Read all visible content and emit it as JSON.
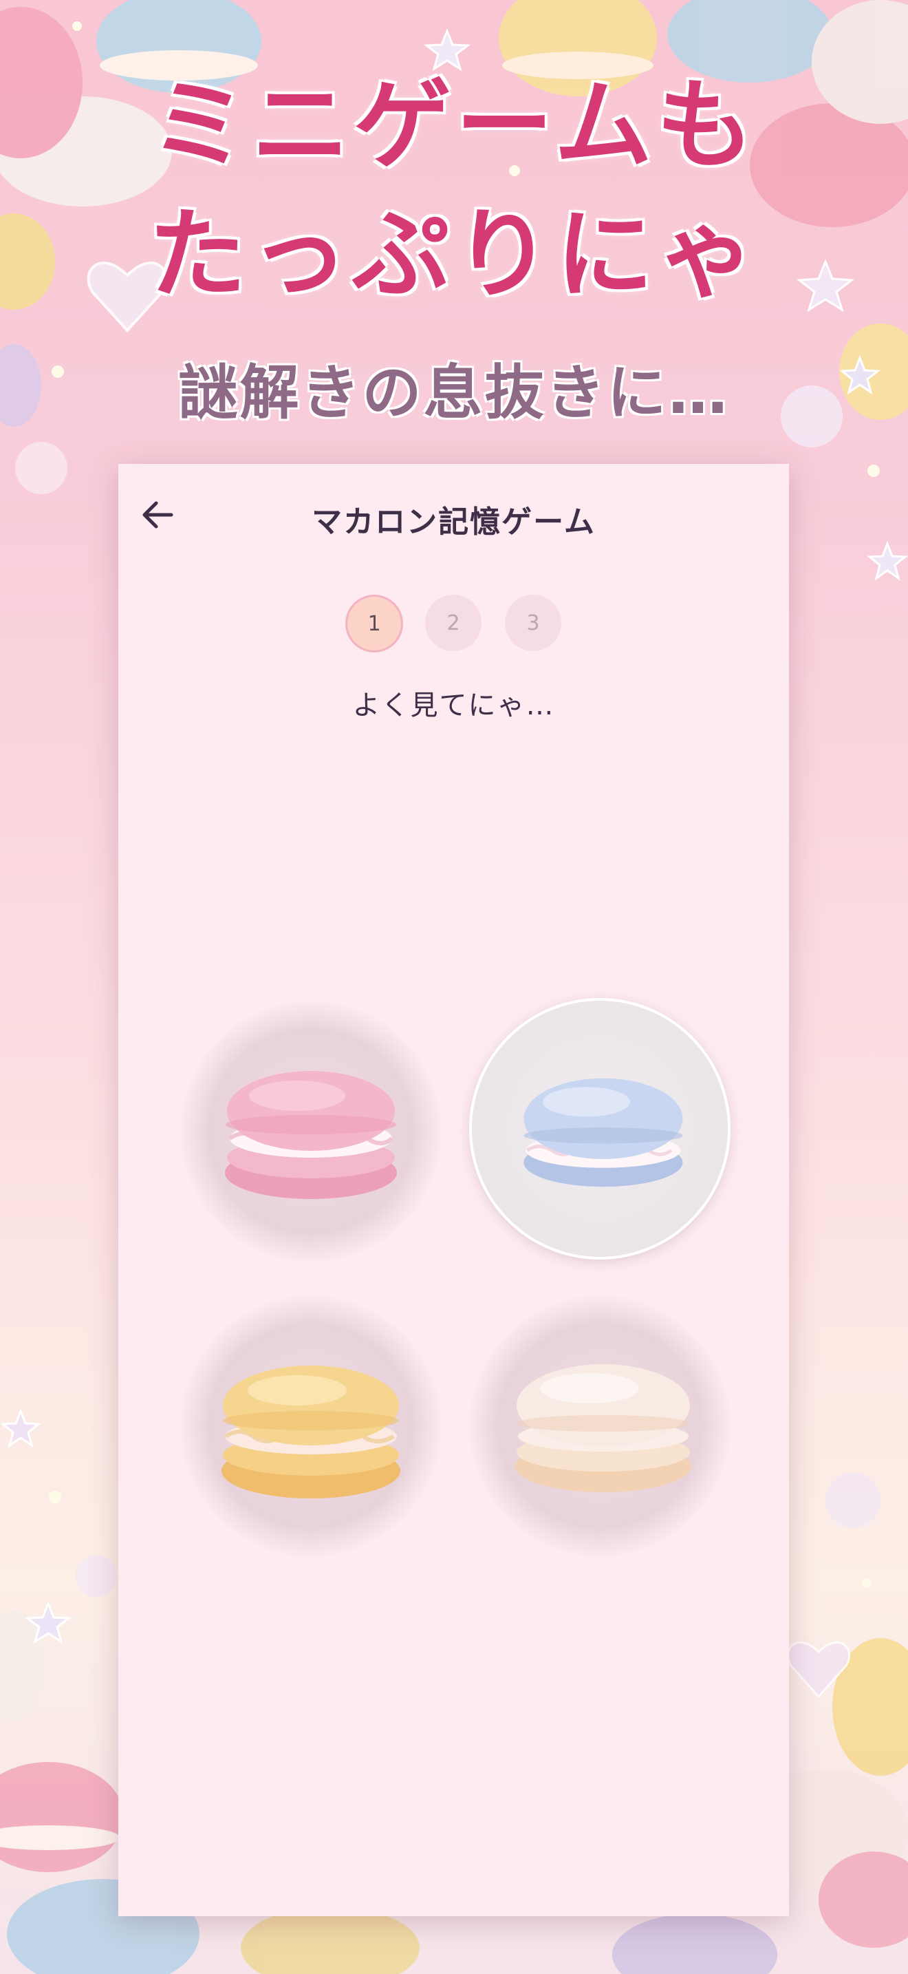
{
  "promo": {
    "headline_line1": "ミニゲームも",
    "headline_line2": "たっぷりにゃ",
    "subheadline": "謎解きの息抜きに…"
  },
  "app": {
    "title": "マカロン記憶ゲーム",
    "back_icon": "arrow-left-icon",
    "steps": [
      {
        "label": "1",
        "state": "active"
      },
      {
        "label": "2",
        "state": "upcoming"
      },
      {
        "label": "3",
        "state": "upcoming"
      }
    ],
    "hint": "よく見てにゃ…",
    "macarons": [
      {
        "color_name": "pink",
        "color": "#f2b6c9",
        "highlighted": false
      },
      {
        "color_name": "blue",
        "color": "#c9d6f0",
        "highlighted": true
      },
      {
        "color_name": "yellow",
        "color": "#f6d48f",
        "highlighted": false
      },
      {
        "color_name": "white",
        "color": "#f5e4d8",
        "highlighted": false
      }
    ]
  },
  "colors": {
    "headline": "#d63a74",
    "subheadline": "#8e6a86",
    "panel": "#feebf1",
    "title_text": "#3e2f48"
  }
}
